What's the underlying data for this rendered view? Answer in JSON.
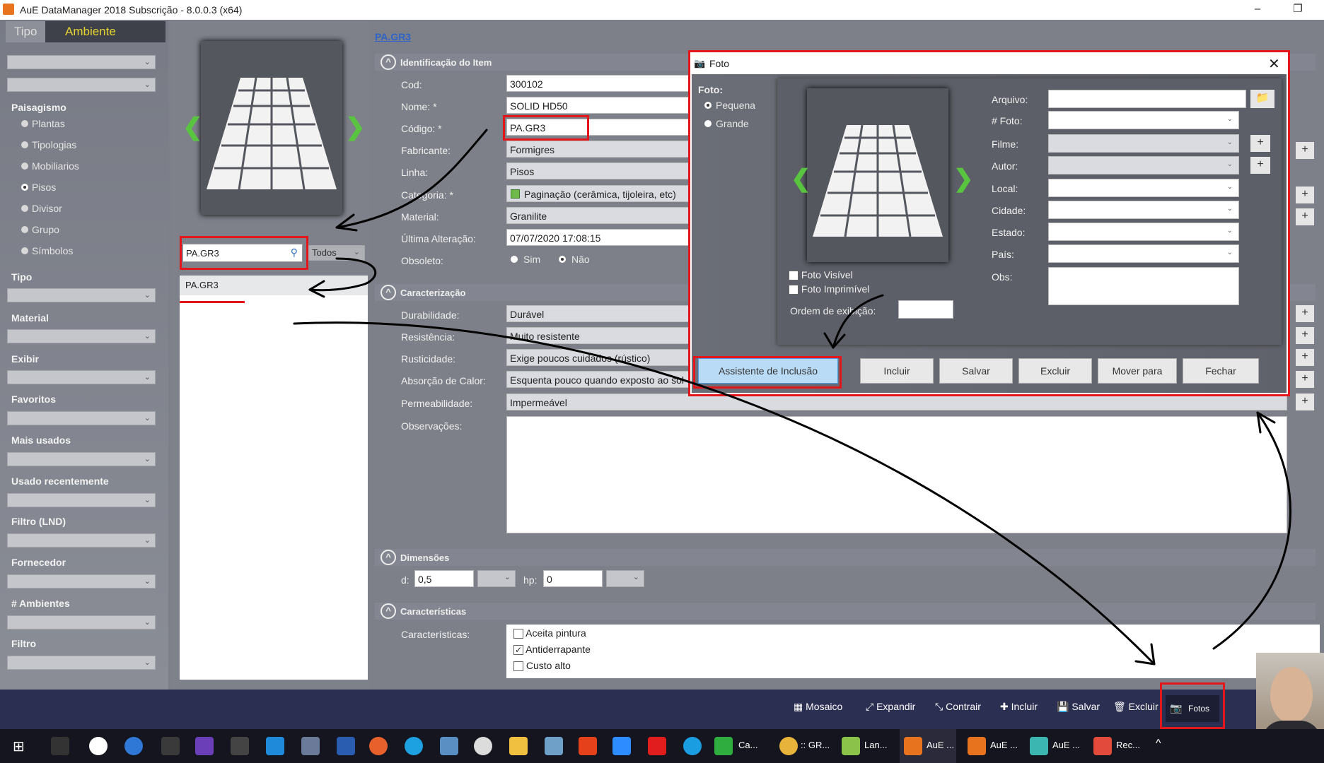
{
  "window": {
    "title": "AuE DataManager 2018 Subscrição - 8.0.0.3 (x64)"
  },
  "left": {
    "tabs": [
      "Tipo",
      "Ambiente"
    ],
    "paisagismo_label": "Paisagismo",
    "radios": [
      "Plantas",
      "Tipologias",
      "Mobiliarios",
      "Pisos",
      "Divisor",
      "Grupo",
      "Símbolos"
    ],
    "selected_radio": "Pisos",
    "filters": [
      "Tipo",
      "Material",
      "Exibir",
      "Favoritos",
      "Mais usados",
      "Usado recentemente",
      "Filtro (LND)",
      "Fornecedor",
      "# Ambientes",
      "Filtro"
    ]
  },
  "middle": {
    "search_value": "PA.GR3",
    "scope": "Todos",
    "results": [
      "PA.GR3"
    ]
  },
  "form": {
    "breadcrumb": "PA.GR3",
    "sec_ident": "Identificação do Item",
    "cod_label": "Cod:",
    "cod": "300102",
    "nome_label": "Nome: *",
    "nome": "SOLID HD50",
    "codigo_label": "Código: *",
    "codigo": "PA.GR3",
    "fabricante_label": "Fabricante:",
    "fabricante": "Formigres",
    "linha_label": "Linha:",
    "linha": "Pisos",
    "categoria_label": "Categoria: *",
    "categoria": "Paginação (cerâmica, tijoleira, etc)",
    "material_label": "Material:",
    "material": "Granilite",
    "ultima_label": "Última Alteração:",
    "ultima": "07/07/2020 17:08:15",
    "obsoleto_label": "Obsoleto:",
    "obs_sim": "Sim",
    "obs_nao": "Não",
    "sec_caract": "Caracterização",
    "durab_label": "Durabilidade:",
    "durab": "Durável",
    "resist_label": "Resistência:",
    "resist": "Muito resistente",
    "rust_label": "Rusticidade:",
    "rust": "Exige poucos cuidados (rústico)",
    "absor_label": "Absorção de Calor:",
    "absor": "Esquenta pouco quando exposto ao sol",
    "perm_label": "Permeabilidade:",
    "perm": "Impermeável",
    "obsv_label": "Observações:",
    "sec_dim": "Dimensões",
    "d_label": "d:",
    "d": "0,5",
    "hp_label": "hp:",
    "hp": "0",
    "sec_car": "Características",
    "car_label": "Características:",
    "car_items": [
      {
        "label": "Aceita pintura",
        "checked": false
      },
      {
        "label": "Antiderrapante",
        "checked": true
      },
      {
        "label": "Custo alto",
        "checked": false
      }
    ]
  },
  "dialog": {
    "title": "Foto",
    "foto_label": "Foto:",
    "size_options": [
      "Pequena",
      "Grande"
    ],
    "selected_size": "Pequena",
    "fields": [
      "Arquivo:",
      "# Foto:",
      "Filme:",
      "Autor:",
      "Local:",
      "Cidade:",
      "Estado:",
      "País:",
      "Obs:"
    ],
    "visivel": "Foto Visível",
    "imprimivel": "Foto Imprimível",
    "ordem_label": "Ordem de exibição:",
    "buttons": [
      "Assistente de Inclusão",
      "Incluir",
      "Salvar",
      "Excluir",
      "Mover para",
      "Fechar"
    ]
  },
  "toolbar": {
    "buttons": [
      "Mosaico",
      "Expandir",
      "Contrair",
      "Incluir",
      "Salvar",
      "Excluir",
      "Fotos"
    ]
  },
  "taskbar": {
    "items": [
      "Ca...",
      ":: GR...",
      "Lan...",
      "AuE ...",
      "AuE ...",
      "AuE ...",
      "Rec..."
    ]
  },
  "colors": {
    "accent_red": "#e3161b",
    "nav_green": "#59c43f",
    "toolbar": "#2b2f52",
    "ambiente_tab": "#e5d430"
  }
}
